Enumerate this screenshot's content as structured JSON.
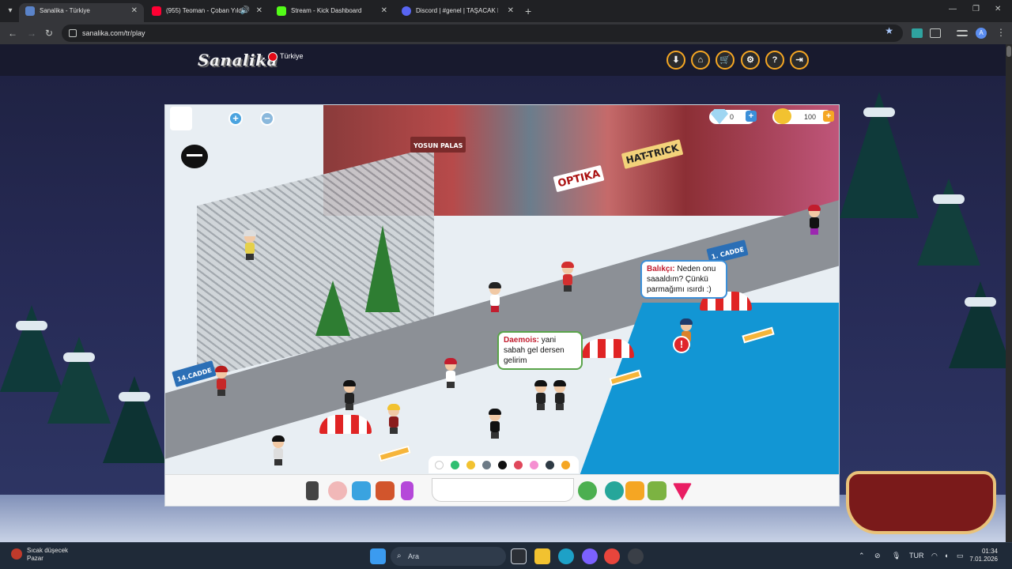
{
  "browser": {
    "tabs": [
      {
        "title": "Sanalika - Türkiye",
        "active": true
      },
      {
        "title": "(955) Teoman - Çoban Yıld",
        "active": false
      },
      {
        "title": "Stream - Kick Dashboard",
        "active": false
      },
      {
        "title": "Discord | #genel | TAŞACAK BU",
        "active": false
      }
    ],
    "url": "sanalika.com/tr/play"
  },
  "site": {
    "logo": "Sanalika",
    "region": "Türkiye",
    "header_buttons": [
      "download-icon",
      "home-icon",
      "cart-icon",
      "gear-icon",
      "help-icon",
      "logout-icon"
    ]
  },
  "game": {
    "diamonds": "0",
    "gold": "100",
    "signs": {
      "street_14": "14.CADDE",
      "street_1": "1. CADDE",
      "optika": "OPTIKA",
      "hattrick": "HAT-TRICK",
      "yosun": "YOSUN PALAS"
    },
    "bubbles": [
      {
        "nick": "Balıkçı:",
        "text": "Neden onu saaaldım? Çünkü parmağımı ısırdı :)"
      },
      {
        "nick": "Daemois:",
        "text": "yani sabah gel dersen gelirim"
      }
    ],
    "swatch_colors": [
      "#ffffff",
      "#2fbf71",
      "#f2c230",
      "#6d7b86",
      "#111111",
      "#e0475b",
      "#f58fd1",
      "#2e3a44",
      "#f5a623"
    ]
  },
  "taskbar": {
    "weather_title": "Sıcak düşecek",
    "weather_sub": "Pazar",
    "search_placeholder": "Ara",
    "lang": "TUR",
    "time": "01:34",
    "date": "7.01.2026"
  }
}
